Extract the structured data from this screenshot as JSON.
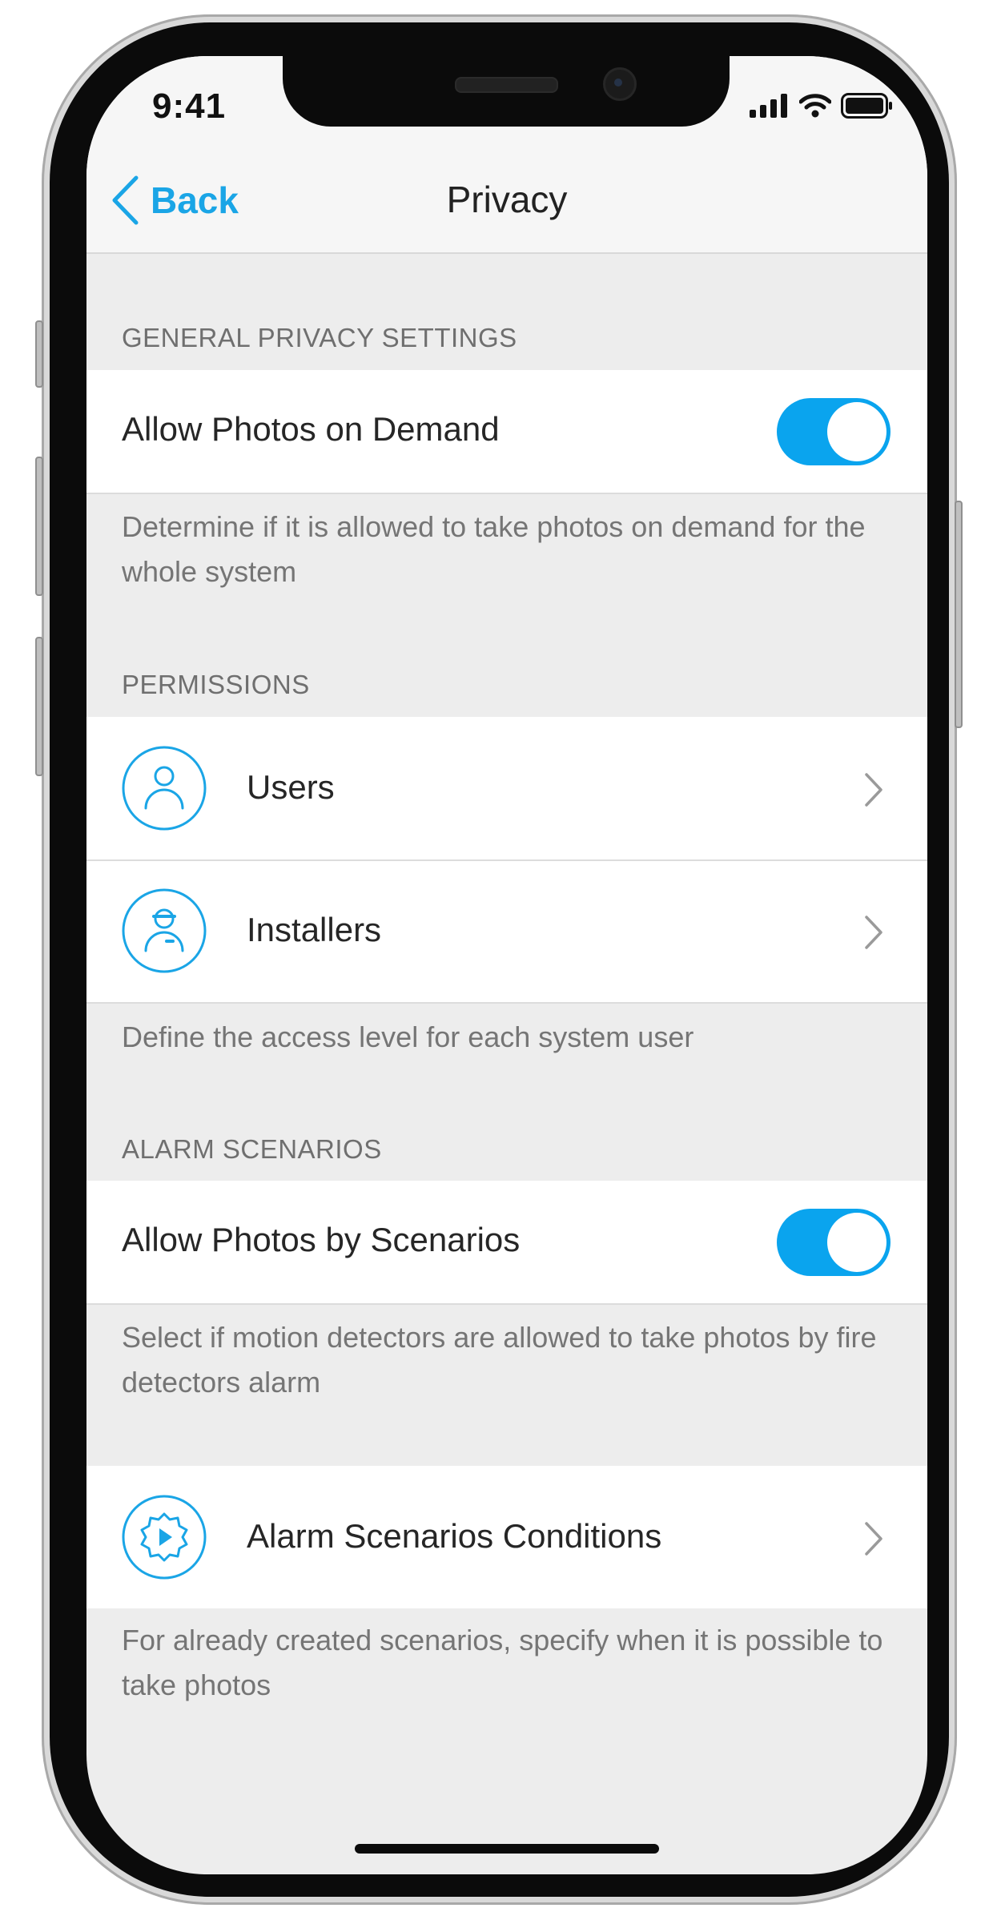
{
  "status": {
    "time": "9:41"
  },
  "nav": {
    "back_label": "Back",
    "title": "Privacy"
  },
  "sections": {
    "general": {
      "header": "GENERAL PRIVACY SETTINGS",
      "toggle_label": "Allow Photos on Demand",
      "toggle_on": true,
      "footer": "Determine if it is allowed to take photos on demand for the whole system"
    },
    "permissions": {
      "header": "PERMISSIONS",
      "items": [
        {
          "label": "Users",
          "icon": "user-icon"
        },
        {
          "label": "Installers",
          "icon": "installer-icon"
        }
      ],
      "footer": "Define the access level for each system user"
    },
    "alarm": {
      "header": "ALARM SCENARIOS",
      "toggle_label": "Allow Photos by Scenarios",
      "toggle_on": true,
      "footer": "Select if motion detectors are allowed to take photos by fire detectors alarm"
    },
    "conditions": {
      "label": "Alarm Scenarios Conditions",
      "icon": "gear-play-icon",
      "footer": "For already created scenarios, specify when it is possible to take photos"
    }
  },
  "colors": {
    "accent": "#0aa4ee",
    "background": "#ededed",
    "cell": "#ffffff"
  }
}
